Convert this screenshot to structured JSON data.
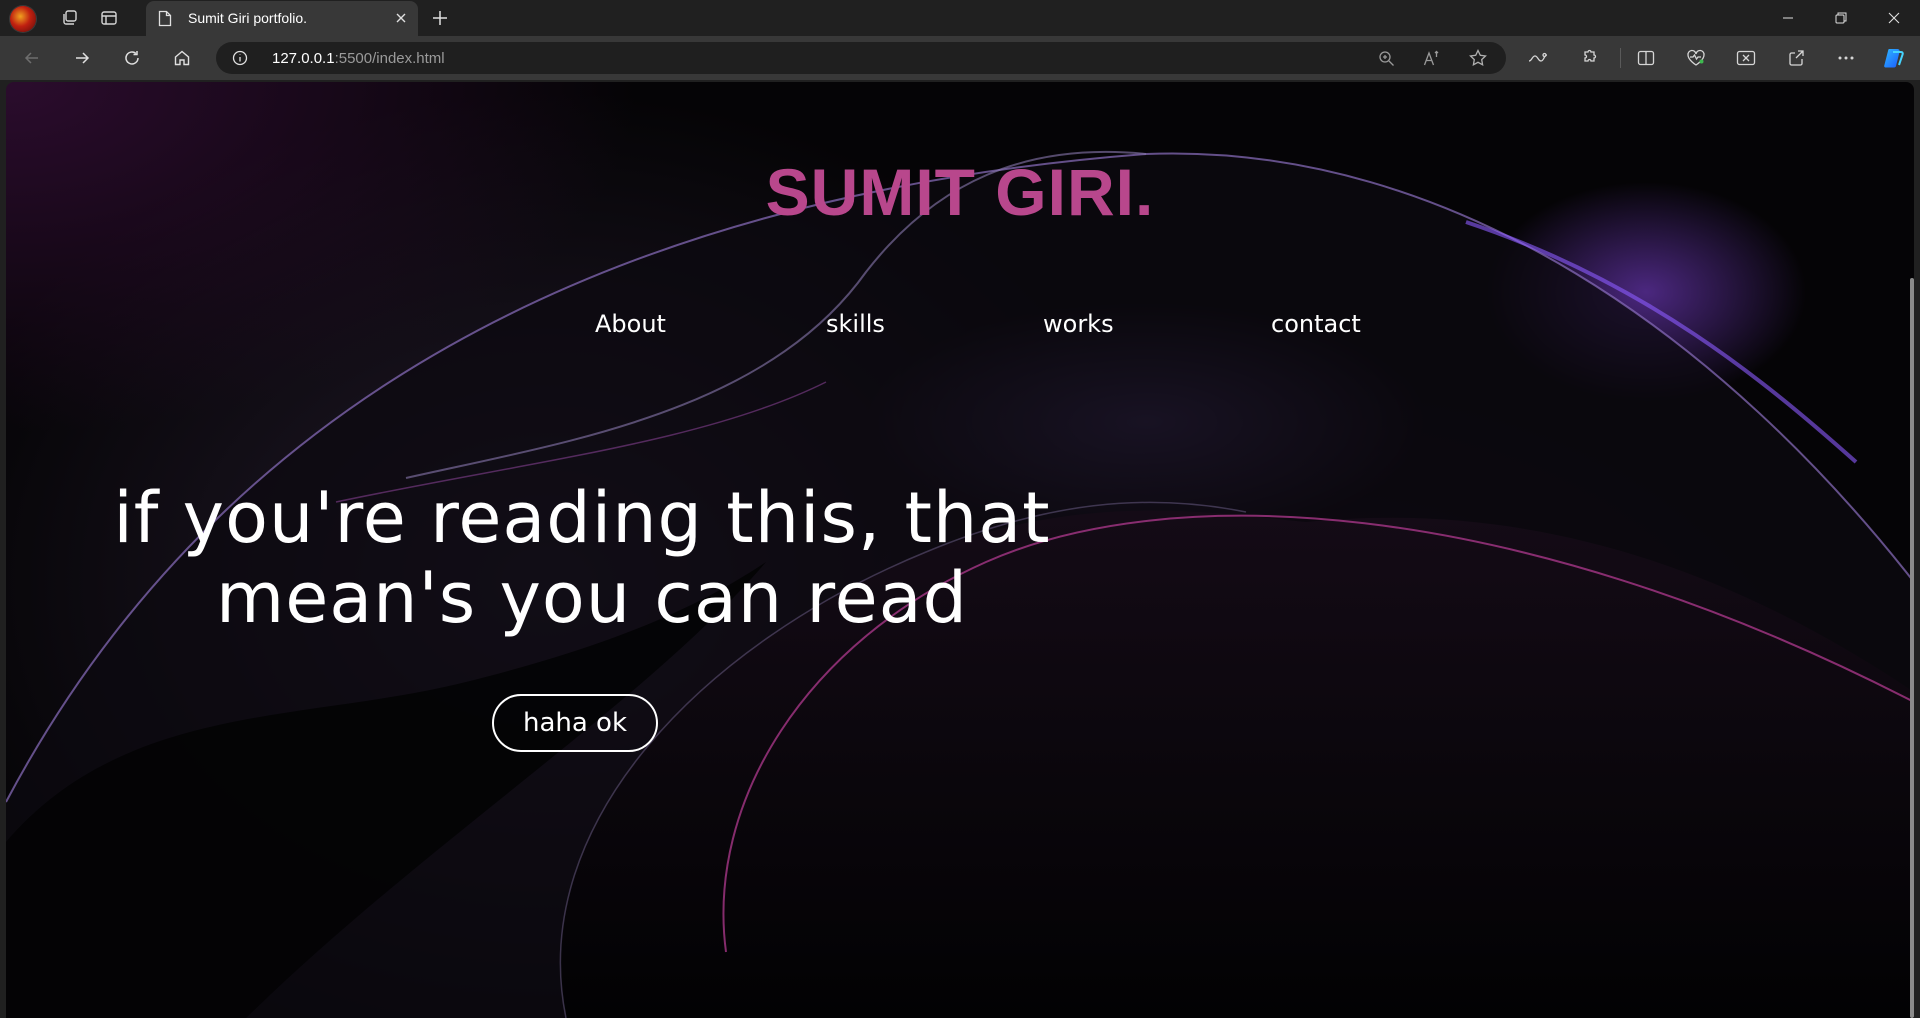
{
  "browser": {
    "tab": {
      "title": "Sumit Giri portfolio."
    },
    "address": {
      "host": "127.0.0.1",
      "path": ":5500/index.html"
    }
  },
  "page": {
    "logo": "SUMIT GIRI.",
    "nav": [
      {
        "label": "About"
      },
      {
        "label": "skills"
      },
      {
        "label": "works"
      },
      {
        "label": "contact"
      }
    ],
    "hero": {
      "line1": "if you're reading this, that",
      "line2": "mean's you can read",
      "button": "haha ok"
    }
  },
  "colors": {
    "logo": "#b8478c",
    "background": "#050406",
    "accent_purple": "#7a3fd0",
    "accent_magenta": "#b03a8f"
  },
  "icons": [
    "profile-avatar",
    "workspaces-icon",
    "vertical-tabs-icon",
    "document-icon",
    "close-icon",
    "plus-icon",
    "minimize-icon",
    "restore-icon",
    "back-icon",
    "forward-icon",
    "refresh-icon",
    "home-icon",
    "info-icon",
    "zoom-icon",
    "read-aloud-icon",
    "favorite-star-icon",
    "performance-icon",
    "extensions-icon",
    "split-screen-icon",
    "browser-essentials-icon",
    "screenshot-icon",
    "share-icon",
    "more-icon",
    "copilot-icon"
  ]
}
